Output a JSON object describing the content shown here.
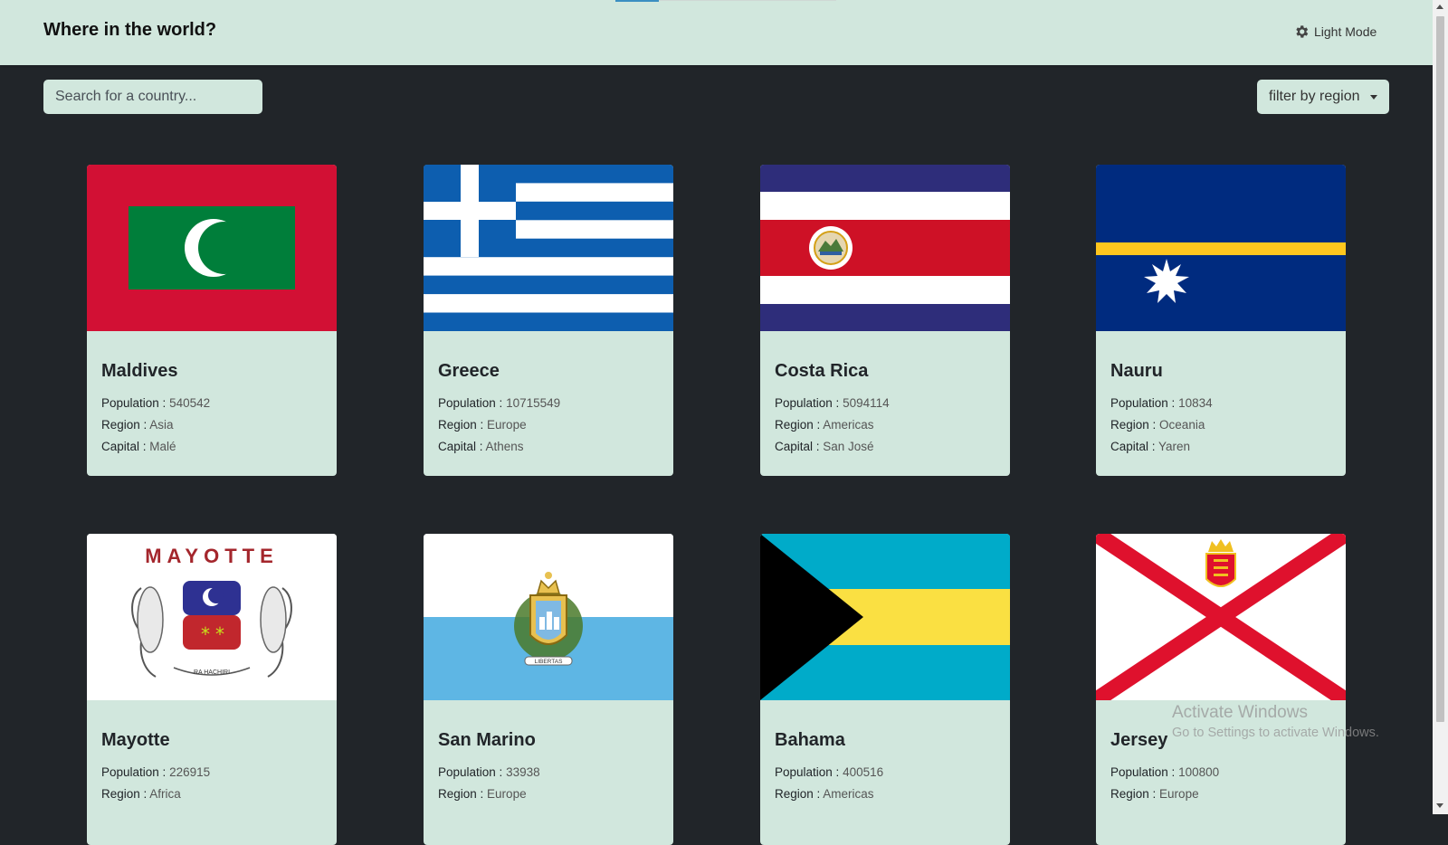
{
  "header": {
    "title": "Where in the world?",
    "theme_toggle_label": "Light Mode",
    "theme_icon": "gear-icon"
  },
  "search": {
    "placeholder": "Search for a country..."
  },
  "filter": {
    "label": "filter by region"
  },
  "labels": {
    "population": "Population : ",
    "region": "Region : ",
    "capital": "Capital : "
  },
  "countries": [
    {
      "name": "Maldives",
      "population": "540542",
      "region": "Asia",
      "capital": "Malé",
      "flag_icon": "maldives-flag"
    },
    {
      "name": "Greece",
      "population": "10715549",
      "region": "Europe",
      "capital": "Athens",
      "flag_icon": "greece-flag"
    },
    {
      "name": "Costa Rica",
      "population": "5094114",
      "region": "Americas",
      "capital": "San José",
      "flag_icon": "costa-rica-flag"
    },
    {
      "name": "Nauru",
      "population": "10834",
      "region": "Oceania",
      "capital": "Yaren",
      "flag_icon": "nauru-flag"
    },
    {
      "name": "Mayotte",
      "population": "226915",
      "region": "Africa",
      "capital": "",
      "flag_icon": "mayotte-flag",
      "flag_text": "MAYOTTE",
      "flag_motto": "RA HACHIRI"
    },
    {
      "name": "San Marino",
      "population": "33938",
      "region": "Europe",
      "capital": "",
      "flag_icon": "san-marino-flag",
      "flag_motto": "LIBERTAS"
    },
    {
      "name": "Bahama",
      "population": "400516",
      "region": "Americas",
      "capital": "",
      "flag_icon": "bahamas-flag"
    },
    {
      "name": "Jersey",
      "population": "100800",
      "region": "Europe",
      "capital": "",
      "flag_icon": "jersey-flag"
    }
  ],
  "watermark": {
    "title": "Activate Windows",
    "subtitle": "Go to Settings to activate Windows."
  },
  "colors": {
    "header_bg": "#d1e7dd",
    "page_bg": "#212529",
    "card_bg": "#d1e7dd"
  }
}
